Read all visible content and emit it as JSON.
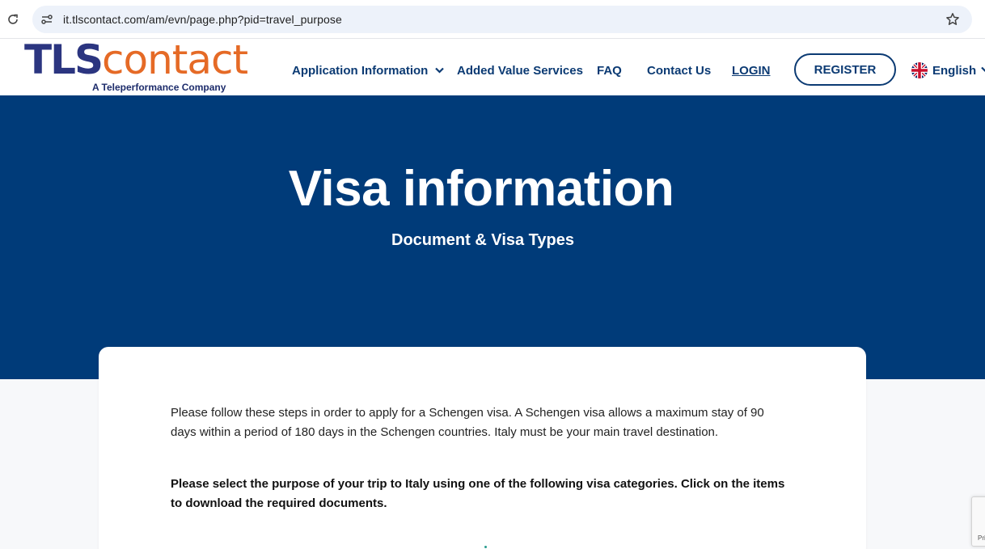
{
  "browser": {
    "url": "it.tlscontact.com/am/evn/page.php?pid=travel_purpose"
  },
  "header": {
    "logo": {
      "tls": "TLS",
      "contact": "contact",
      "tagline": "A Teleperformance Company"
    },
    "nav": {
      "application_information": "Application Information",
      "added_value_services": "Added Value Services",
      "faq": "FAQ",
      "contact_us": "Contact Us",
      "login": "LOGIN",
      "register": "REGISTER",
      "language": "English"
    }
  },
  "hero": {
    "title": "Visa information",
    "subtitle": "Document & Visa Types"
  },
  "content": {
    "intro": "Please follow these steps in order to apply for a Schengen visa. A Schengen visa allows a maximum stay of 90 days within a period of 180 days in the Schengen countries. Italy must be your main travel destination.",
    "instruction": "Please select the purpose of your trip to Italy using one of the following visa categories. Click on the items to download the required documents."
  },
  "recaptcha": {
    "text": "Pri"
  },
  "colors": {
    "navy": "#003b79",
    "nav_text": "#0b3a73",
    "logo_blue": "#2b3580",
    "logo_orange": "#e56a26",
    "page_bg": "#f7f8fa"
  },
  "icons": {
    "reload": "reload-icon",
    "site_info": "site-info-icon",
    "bookmark": "star-icon",
    "dropdown": "chevron-down-icon",
    "language_flag": "uk-flag-icon"
  }
}
